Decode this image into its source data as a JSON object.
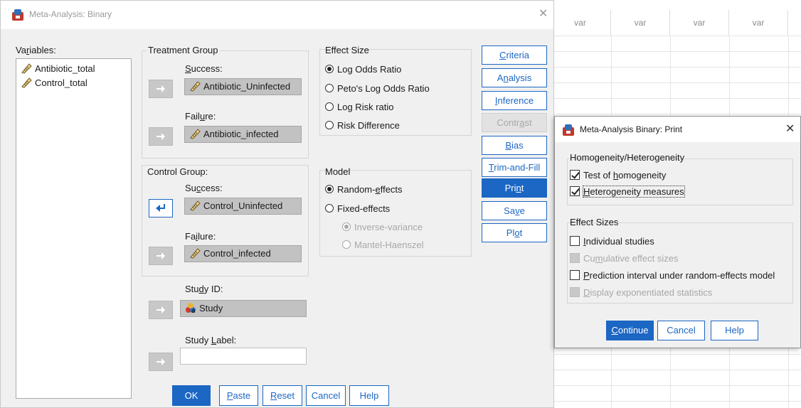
{
  "grid": {
    "headers": [
      "var",
      "var",
      "var",
      "var"
    ]
  },
  "dialog": {
    "title": "Meta-Analysis: Binary",
    "variables_label": "Variables:",
    "variables": [
      "Antibiotic_total",
      "Control_total"
    ],
    "treatment_group": {
      "title": "Treatment Group",
      "success_label": "Success:",
      "success_value": "Antibiotic_Uninfected",
      "failure_label": "Failure:",
      "failure_value": "Antibiotic_infected"
    },
    "control_group": {
      "title": "Control Group:",
      "success_label": "Success:",
      "success_value": "Control_Uninfected",
      "failure_label": "Failure:",
      "failure_value": "Control_infected"
    },
    "study_id": {
      "label": "Study ID:",
      "value": "Study"
    },
    "study_label": {
      "label": "Study Label:",
      "value": ""
    },
    "effect_size": {
      "title": "Effect Size",
      "options": [
        "Log Odds Ratio",
        "Peto's Log Odds Ratio",
        "Log Risk ratio",
        "Risk Difference"
      ],
      "selected": "Log Odds Ratio"
    },
    "model": {
      "title": "Model",
      "options": [
        "Random-effects",
        "Fixed-effects"
      ],
      "selected": "Random-effects",
      "sub_options": [
        "Inverse-variance",
        "Mantel-Haenszel"
      ],
      "sub_selected": "Inverse-variance"
    },
    "side_buttons": [
      "Criteria",
      "Analysis",
      "Inference",
      "Contrast",
      "Bias",
      "Trim-and-Fill",
      "Print",
      "Save",
      "Plot"
    ],
    "bottom_buttons": [
      "OK",
      "Paste",
      "Reset",
      "Cancel",
      "Help"
    ]
  },
  "print_dialog": {
    "title": "Meta-Analysis Binary: Print",
    "homogeneity_group": "Homogeneity/Heterogeneity",
    "test_of_homogeneity": "Test of homogeneity",
    "heterogeneity_measures": "Heterogeneity measures",
    "effect_sizes_group": "Effect Sizes",
    "individual_studies": "Individual studies",
    "cumulative_effect_sizes": "Cumulative effect sizes",
    "prediction_interval": "Prediction interval under random-effects model",
    "display_exponentiated": "Display exponentiated statistics",
    "buttons": [
      "Continue",
      "Cancel",
      "Help"
    ]
  }
}
